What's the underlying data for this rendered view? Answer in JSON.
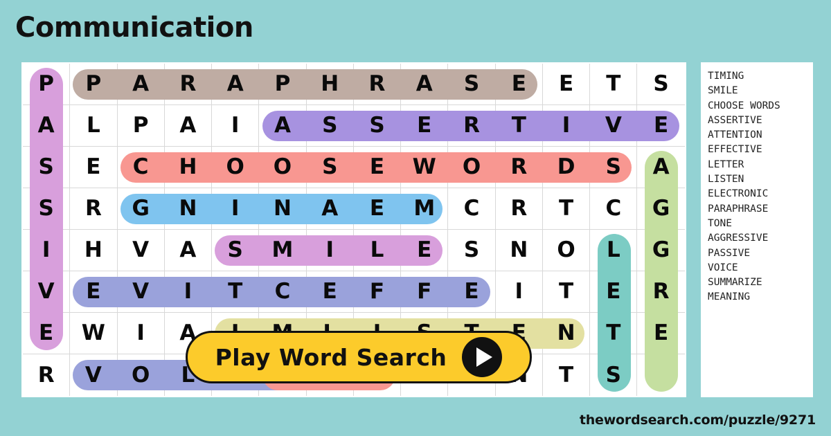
{
  "page": {
    "title": "Communication",
    "background_color": "#93d2d3",
    "footer_url": "thewordsearch.com/puzzle/9271"
  },
  "play_button": {
    "label": "Play Word Search",
    "icon": "play-triangle-icon",
    "background_color": "#fccb2b"
  },
  "grid": {
    "columns": 14,
    "rows": 8,
    "letters": [
      [
        "P",
        "P",
        "A",
        "R",
        "A",
        "P",
        "H",
        "R",
        "A",
        "S",
        "E",
        "E",
        "T",
        "S"
      ],
      [
        "A",
        "L",
        "P",
        "A",
        "I",
        "A",
        "S",
        "S",
        "E",
        "R",
        "T",
        "I",
        "V",
        "E"
      ],
      [
        "S",
        "E",
        "C",
        "H",
        "O",
        "O",
        "S",
        "E",
        "W",
        "O",
        "R",
        "D",
        "S",
        "A"
      ],
      [
        "S",
        "R",
        "G",
        "N",
        "I",
        "N",
        "A",
        "E",
        "M",
        "C",
        "R",
        "T",
        "C",
        "G"
      ],
      [
        "I",
        "H",
        "V",
        "A",
        "S",
        "M",
        "I",
        "L",
        "E",
        "S",
        "N",
        "O",
        "L",
        "G"
      ],
      [
        "V",
        "E",
        "V",
        "I",
        "T",
        "C",
        "E",
        "F",
        "F",
        "E",
        "I",
        "T",
        "E",
        "R"
      ],
      [
        "E",
        "W",
        "I",
        "A",
        "I",
        "M",
        "L",
        "I",
        "S",
        "T",
        "E",
        "N",
        "T",
        "E"
      ],
      [
        "R",
        "V",
        "O",
        "L",
        "E",
        "O",
        "H",
        "I",
        "C",
        "E",
        "N",
        "T",
        "S",
        " "
      ]
    ],
    "highlights": [
      {
        "word": "PASSIVE",
        "color": "#d89fdc",
        "orientation": "vertical",
        "col": 0,
        "row": 0,
        "length": 7
      },
      {
        "word": "PARAPHRASE",
        "color": "#bfaca3",
        "orientation": "horizontal",
        "col": 1,
        "row": 0,
        "length": 10
      },
      {
        "word": "ASSERTIVE",
        "color": "#a792e0",
        "orientation": "horizontal",
        "col": 5,
        "row": 1,
        "length": 9
      },
      {
        "word": "CHOOSE WORDS",
        "color": "#f89791",
        "orientation": "horizontal",
        "col": 2,
        "row": 2,
        "length": 11
      },
      {
        "word": "MEANING",
        "color": "#7fc4ef",
        "orientation": "horizontal",
        "col": 2,
        "row": 3,
        "length": 7
      },
      {
        "word": "AGGRESSIVE",
        "color": "#c5dfa0",
        "orientation": "vertical",
        "col": 13,
        "row": 2,
        "length": 6
      },
      {
        "word": "SMILE",
        "color": "#d89fdc",
        "orientation": "horizontal",
        "col": 4,
        "row": 4,
        "length": 5
      },
      {
        "word": "ELECTRONIC",
        "color": "#7cccc4",
        "orientation": "vertical",
        "col": 12,
        "row": 4,
        "length": 4
      },
      {
        "word": "EFFECTIVE",
        "color": "#9aa2db",
        "orientation": "horizontal",
        "col": 1,
        "row": 5,
        "length": 9
      },
      {
        "word": "LISTEN",
        "color": "#e3e0a1",
        "orientation": "horizontal",
        "col": 4,
        "row": 6,
        "length": 8
      },
      {
        "word": "VOICE",
        "color": "#9aa2db",
        "orientation": "horizontal",
        "col": 1,
        "row": 7,
        "length": 6
      },
      {
        "word": "TIMING",
        "color": "#f89791",
        "orientation": "horizontal",
        "col": 5,
        "row": 7,
        "length": 3
      }
    ]
  },
  "word_list": [
    "TIMING",
    "SMILE",
    "CHOOSE WORDS",
    "ASSERTIVE",
    "ATTENTION",
    "EFFECTIVE",
    "LETTER",
    "LISTEN",
    "ELECTRONIC",
    "PARAPHRASE",
    "TONE",
    "AGGRESSIVE",
    "PASSIVE",
    "VOICE",
    "SUMMARIZE",
    "MEANING"
  ]
}
